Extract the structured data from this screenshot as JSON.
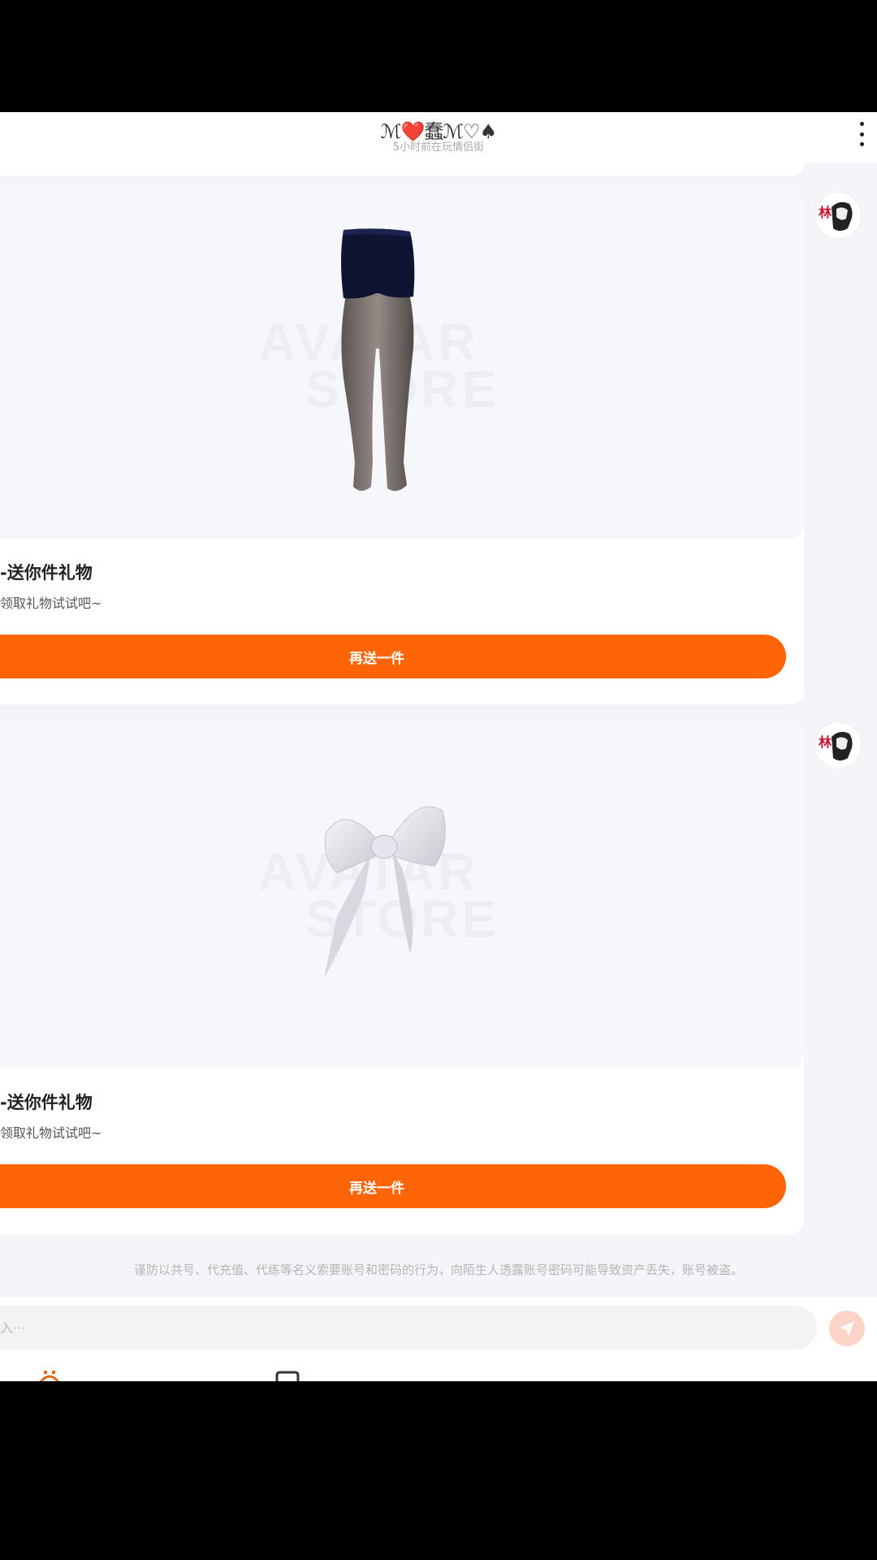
{
  "header": {
    "name": "ℳ❤️蠢ℳ♡♠",
    "status": "5小时前在玩情侣街"
  },
  "cards": [
    {
      "title": "-送你件礼物",
      "subtitle": "领取礼物试试吧~",
      "button_label": "再送一件",
      "watermark_line1": "AVATAR",
      "watermark_line2": "STORE",
      "item_icon": "tights-shorts-item",
      "avatar_text": "林"
    },
    {
      "title": "-送你件礼物",
      "subtitle": "领取礼物试试吧~",
      "button_label": "再送一件",
      "watermark_line1": "AVATAR",
      "watermark_line2": "STORE",
      "item_icon": "white-bow-item",
      "avatar_text": "林"
    }
  ],
  "notice": "谨防以共号、代充值、代练等名义索要账号和密码的行为，向陌生人透露账号密码可能导致资产丢失，账号被盗。",
  "input": {
    "placeholder": "入···"
  },
  "colors": {
    "accent": "#ff6507",
    "send_disabled": "#fbd3c7"
  }
}
